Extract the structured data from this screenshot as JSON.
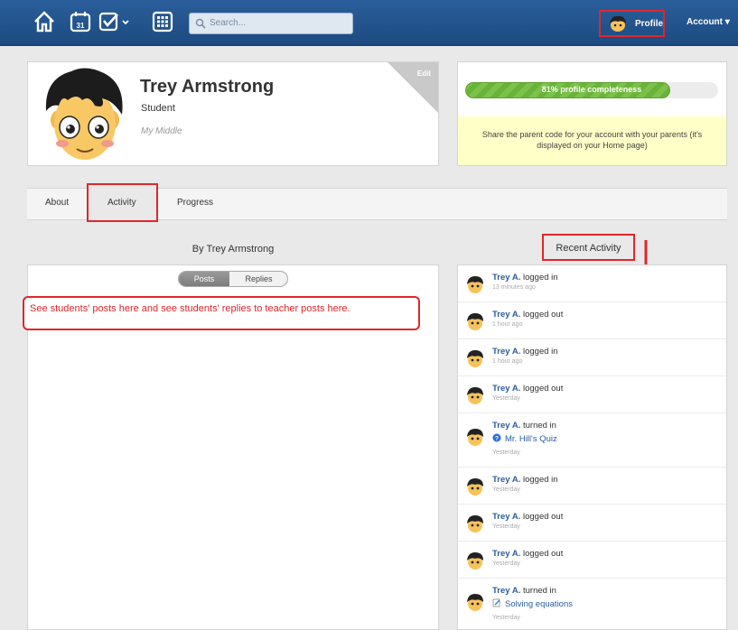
{
  "topbar": {
    "search_placeholder": "Search...",
    "profile_label": "Profile",
    "account_label": "Account ▾"
  },
  "profile": {
    "name": "Trey Armstrong",
    "role": "Student",
    "school": "My Middle",
    "edit_label": "Edit"
  },
  "completeness": {
    "percent": 81,
    "label": "81% profile completeness",
    "note": "Share the parent code for your account with your parents (it's displayed on your Home page)"
  },
  "tabs": {
    "about": "About",
    "activity": "Activity",
    "progress": "Progress"
  },
  "left": {
    "heading": "By Trey Armstrong",
    "seg_posts": "Posts",
    "seg_replies": "Replies",
    "callout": "See students' posts here and see students' replies to teacher posts here."
  },
  "recent": {
    "heading": "Recent Activity",
    "items": [
      {
        "user": "Trey A.",
        "action": "logged in",
        "time": "13 minutes ago"
      },
      {
        "user": "Trey A.",
        "action": "logged out",
        "time": "1 hour ago"
      },
      {
        "user": "Trey A.",
        "action": "logged in",
        "time": "1 hour ago"
      },
      {
        "user": "Trey A.",
        "action": "logged out",
        "time": "Yesterday"
      },
      {
        "user": "Trey A.",
        "action": "turned in",
        "link": "Mr. Hill's Quiz",
        "time": "Yesterday"
      },
      {
        "user": "Trey A.",
        "action": "logged in",
        "time": "Yesterday"
      },
      {
        "user": "Trey A.",
        "action": "logged out",
        "time": "Yesterday"
      },
      {
        "user": "Trey A.",
        "action": "logged out",
        "time": "Yesterday"
      },
      {
        "user": "Trey A.",
        "action": "turned in",
        "link": "Solving equations",
        "time": "Yesterday"
      }
    ]
  }
}
